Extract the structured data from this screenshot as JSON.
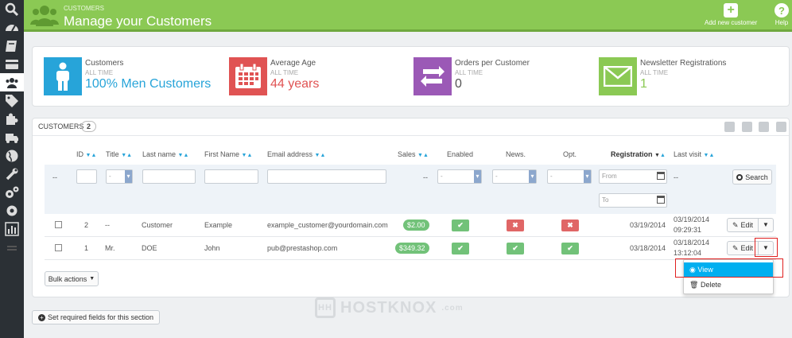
{
  "header": {
    "breadcrumb": "Customers",
    "title": "Manage your Customers",
    "add_label": "Add new customer",
    "help_label": "Help"
  },
  "kpis": [
    {
      "label": "Customers",
      "period": "ALL TIME",
      "value": "100% Men Customers",
      "color": "#27a4d9",
      "icon": "person-icon"
    },
    {
      "label": "Average Age",
      "period": "ALL TIME",
      "value": "44 years",
      "color": "#e05353",
      "icon": "calendar-icon"
    },
    {
      "label": "Orders per Customer",
      "period": "ALL TIME",
      "value": "0",
      "color": "#9b59b6",
      "icon": "retweet-icon"
    },
    {
      "label": "Newsletter Registrations",
      "period": "ALL TIME",
      "value": "1",
      "color": "#8bc954",
      "icon": "envelope-icon"
    }
  ],
  "panel": {
    "title": "Customers",
    "count": "2"
  },
  "columns": {
    "id": "ID",
    "title": "Title",
    "last_name": "Last name",
    "first_name": "First Name",
    "email": "Email address",
    "sales": "Sales",
    "enabled": "Enabled",
    "news": "News.",
    "opt": "Opt.",
    "registration": "Registration",
    "last_visit": "Last visit"
  },
  "filters": {
    "dash": "--",
    "select_dash": "-",
    "from_placeholder": "From",
    "to_placeholder": "To",
    "search_label": "Search"
  },
  "rows": [
    {
      "id": "2",
      "title": "--",
      "last_name": "Customer",
      "first_name": "Example",
      "email": "example_customer@yourdomain.com",
      "sales": "$2.00",
      "registration": "03/19/2014",
      "last_visit_date": "03/19/2014",
      "last_visit_time": "09:29:31"
    },
    {
      "id": "1",
      "title": "Mr.",
      "last_name": "DOE",
      "first_name": "John",
      "email": "pub@prestashop.com",
      "sales": "$349.32",
      "registration": "03/18/2014",
      "last_visit_date": "03/18/2014",
      "last_visit_time": "13:12:04"
    }
  ],
  "actions": {
    "edit": "Edit",
    "view": "View",
    "delete": "Delete",
    "bulk": "Bulk actions",
    "required_fields": "Set required fields for this section"
  },
  "watermark": {
    "badge": "HH",
    "name": "HOSTKNOX",
    "tld": ".com"
  }
}
